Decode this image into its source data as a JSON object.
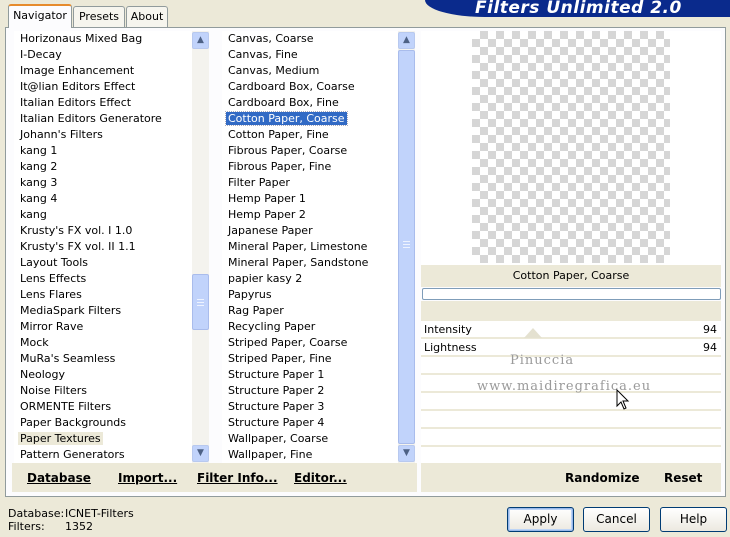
{
  "title_banner": "Filters Unlimited 2.0",
  "tabs": [
    {
      "label": "Navigator",
      "active": true
    },
    {
      "label": "Presets",
      "active": false
    },
    {
      "label": "About",
      "active": false
    }
  ],
  "categories": [
    "Horizonaus Mixed Bag",
    "I-Decay",
    "Image Enhancement",
    "It@lian Editors Effect",
    "Italian Editors Effect",
    "Italian Editors Generatore",
    "Johann's Filters",
    "kang 1",
    "kang 2",
    "kang 3",
    "kang 4",
    "kang",
    "Krusty's FX vol. I 1.0",
    "Krusty's FX vol. II 1.1",
    "Layout Tools",
    "Lens Effects",
    "Lens Flares",
    "MediaSpark Filters",
    "Mirror Rave",
    "Mock",
    "MuRa's Seamless",
    "Neology",
    "Noise Filters",
    "ORMENTE Filters",
    "Paper Backgrounds",
    "Paper Textures",
    "Pattern Generators"
  ],
  "selected_category": "Paper Textures",
  "filters": [
    "Canvas, Coarse",
    "Canvas, Fine",
    "Canvas, Medium",
    "Cardboard Box, Coarse",
    "Cardboard Box, Fine",
    "Cotton Paper, Coarse",
    "Cotton Paper, Fine",
    "Fibrous Paper, Coarse",
    "Fibrous Paper, Fine",
    "Filter Paper",
    "Hemp Paper 1",
    "Hemp Paper 2",
    "Japanese Paper",
    "Mineral Paper, Limestone",
    "Mineral Paper, Sandstone",
    "papier kasy 2",
    "Papyrus",
    "Rag Paper",
    "Recycling Paper",
    "Striped Paper, Coarse",
    "Striped Paper, Fine",
    "Structure Paper 1",
    "Structure Paper 2",
    "Structure Paper 3",
    "Structure Paper 4",
    "Wallpaper, Coarse",
    "Wallpaper, Fine"
  ],
  "selected_filter": "Cotton Paper, Coarse",
  "left_buttons": {
    "database": "Database",
    "import": "Import...",
    "filter_info": "Filter Info...",
    "editor": "Editor..."
  },
  "preview_label": "Cotton Paper, Coarse",
  "progress": 0,
  "parameters": [
    {
      "name": "Intensity",
      "value": "94"
    },
    {
      "name": "Lightness",
      "value": "94"
    }
  ],
  "watermark": {
    "line1": "Pinuccia",
    "line2": "www.maidiregrafica.eu"
  },
  "right_buttons": {
    "randomize": "Randomize",
    "reset": "Reset"
  },
  "status": {
    "database_label": "Database:",
    "database_value": "ICNET-Filters",
    "filters_label": "Filters:",
    "filters_value": "1352"
  },
  "dialog_buttons": {
    "apply": "Apply",
    "cancel": "Cancel",
    "help": "Help"
  }
}
